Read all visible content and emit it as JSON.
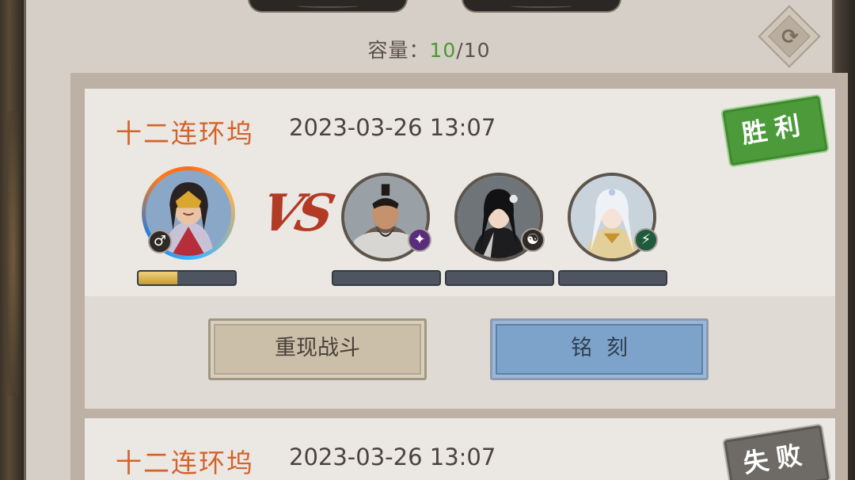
{
  "header": {
    "capacity_label": "容量：",
    "capacity_current": "10",
    "capacity_sep_max": "/10",
    "refresh_icon": "refresh-icon"
  },
  "records": [
    {
      "map_name": "十二连环坞",
      "time": "2023-03-26 13:07",
      "result": "胜利",
      "vs_label": "VS",
      "player": {
        "badge_icon": "male-icon",
        "badge_glyph": "♂",
        "progress": 0.4
      },
      "opponents": [
        {
          "badge_icon": "dagger-icon",
          "badge_glyph": "✦",
          "progress": 0
        },
        {
          "badge_icon": "yin-yang-icon",
          "badge_glyph": "☯",
          "progress": 0
        },
        {
          "badge_icon": "boot-icon",
          "badge_glyph": "⚡",
          "progress": 0
        }
      ],
      "buttons": {
        "replay": "重现战斗",
        "engrave": "铭刻"
      }
    },
    {
      "map_name": "十二连环坞",
      "time": "2023-03-26 13:07",
      "result": "失败"
    }
  ],
  "colors": {
    "map_name": "#d4632a",
    "win_stamp": "#4d9a3a",
    "lose_stamp": "#6e6a66",
    "capacity_current": "#4a9a2f",
    "engrave_button": "#7ea3cb",
    "replay_button": "#cbbfa9"
  }
}
